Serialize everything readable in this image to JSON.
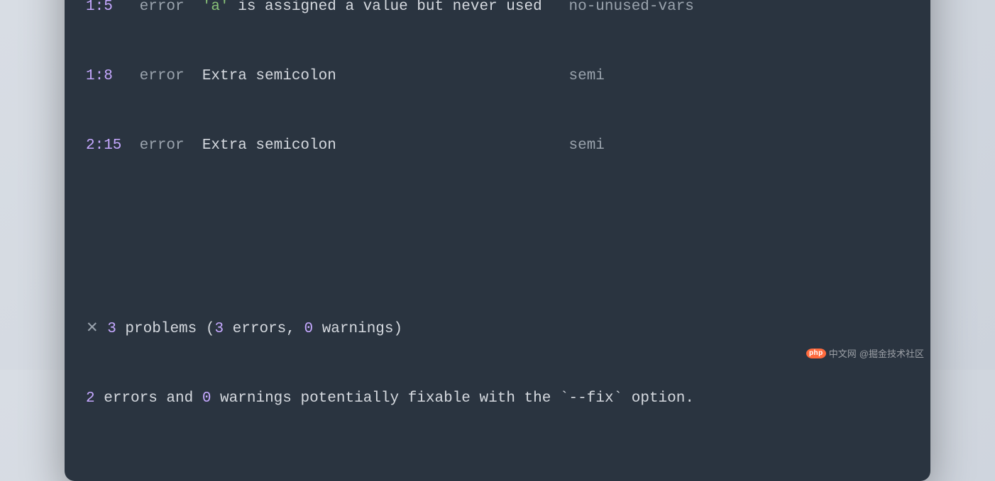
{
  "errors": [
    {
      "loc": "1:5",
      "severity": "error",
      "msg_pre": "",
      "msg_quote": "'a'",
      "msg_post": " is assigned a value but never used",
      "rule": "no-unused-vars"
    },
    {
      "loc": "1:8",
      "severity": "error",
      "msg_pre": "Extra semicolon",
      "msg_quote": "",
      "msg_post": "",
      "rule": "semi"
    },
    {
      "loc": "2:15",
      "severity": "error",
      "msg_pre": "Extra semicolon",
      "msg_quote": "",
      "msg_post": "",
      "rule": "semi"
    }
  ],
  "summary": {
    "cross": "✕",
    "count": "3",
    "text_problems": " problems (",
    "err_count": "3",
    "text_errors": " errors, ",
    "warn_count": "0",
    "text_warnings": " warnings)"
  },
  "fixable": {
    "err": "2",
    "text1": " errors and ",
    "warn": "0",
    "text2": " warnings potentially fixable with the `--fix` option."
  },
  "watermark": {
    "chip": "php",
    "cn": "中文网",
    "at": "@掘金技术社区"
  }
}
